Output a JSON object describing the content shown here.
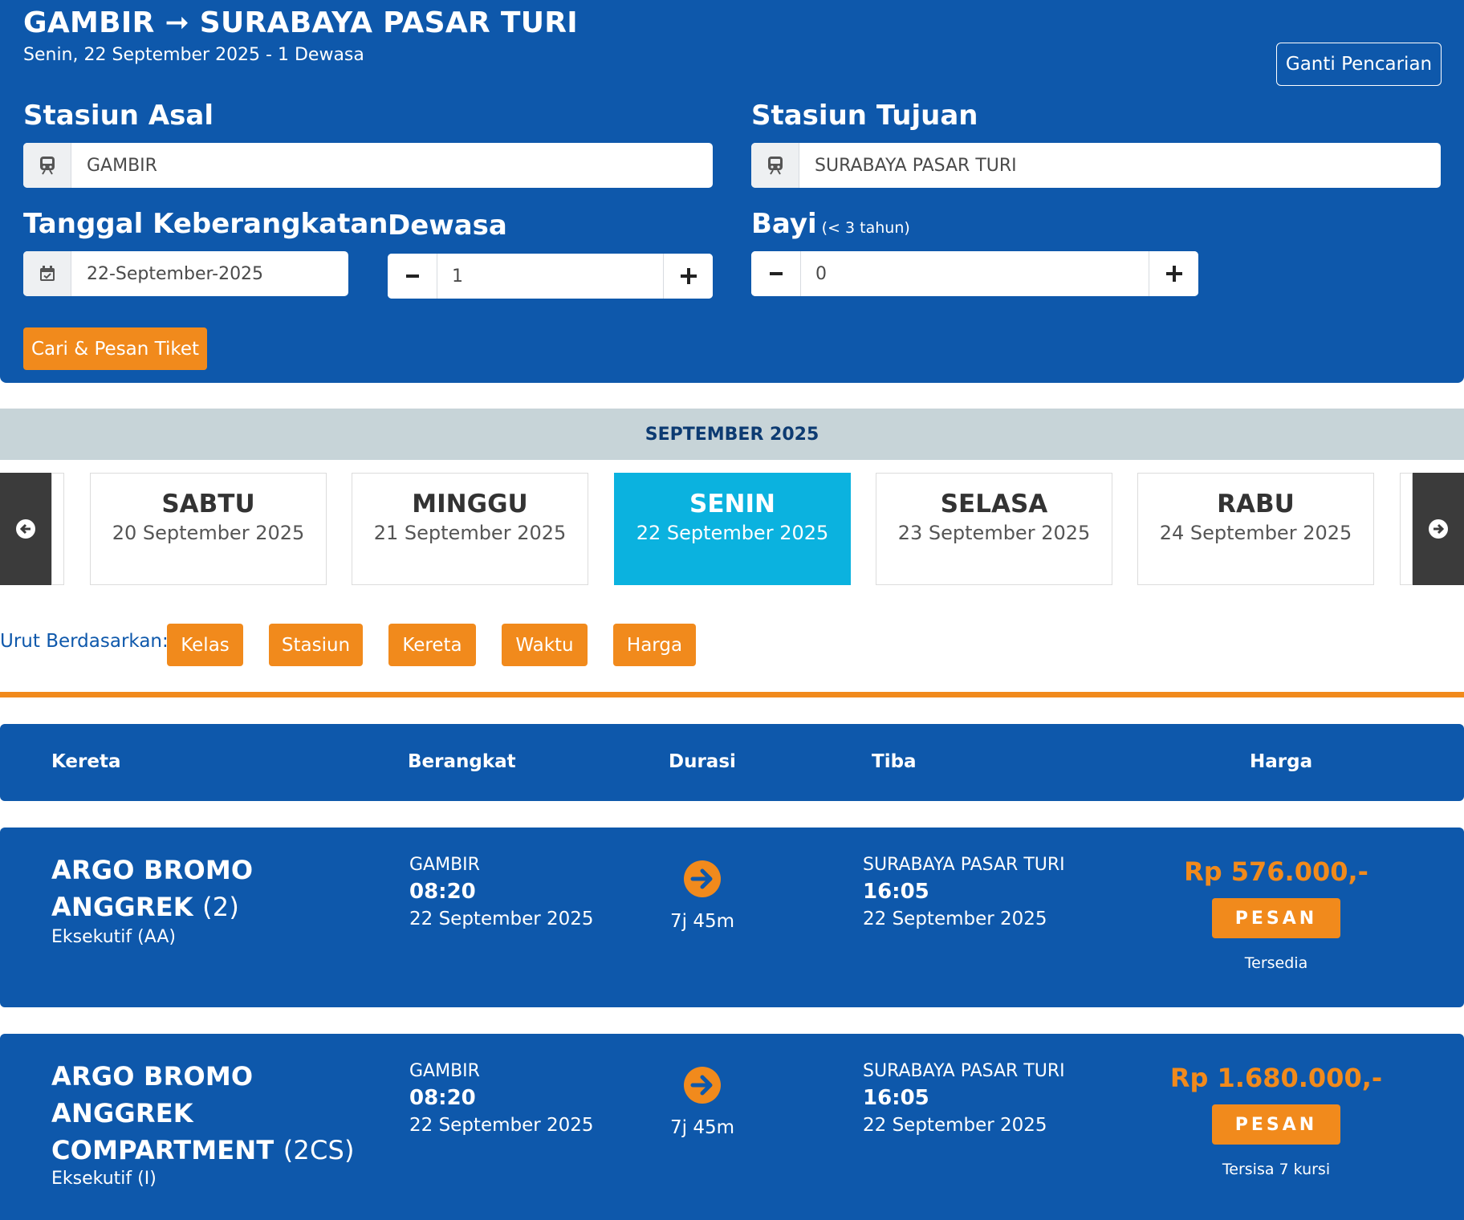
{
  "header": {
    "from": "GAMBIR",
    "arrow": "➞",
    "to": "SURABAYA PASAR TURI",
    "subtitle": "Senin, 22 September 2025 - 1 Dewasa",
    "change_button": "Ganti Pencarian"
  },
  "form": {
    "origin_label": "Stasiun Asal",
    "origin_value": "GAMBIR",
    "destination_label": "Stasiun Tujuan",
    "destination_value": "SURABAYA PASAR TURI",
    "date_label": "Tanggal Keberangkatan",
    "date_value": "22-September-2025",
    "adult_label": "Dewasa",
    "adult_value": "1",
    "infant_label": "Bayi",
    "infant_note": "(< 3 tahun)",
    "infant_value": "0",
    "search_button": "Cari & Pesan Tiket"
  },
  "calendar": {
    "month": "SEPTEMBER 2025",
    "days": [
      {
        "name": "SABTU",
        "date": "20 September 2025"
      },
      {
        "name": "MINGGU",
        "date": "21 September 2025"
      },
      {
        "name": "SENIN",
        "date": "22 September 2025"
      },
      {
        "name": "SELASA",
        "date": "23 September 2025"
      },
      {
        "name": "RABU",
        "date": "24 September 2025"
      }
    ],
    "active_index": 2
  },
  "sort": {
    "label": "Urut Berdasarkan:",
    "options": [
      "Kelas",
      "Stasiun",
      "Kereta",
      "Waktu",
      "Harga"
    ]
  },
  "table": {
    "headers": [
      "Kereta",
      "Berangkat",
      "Durasi",
      "Tiba",
      "Harga"
    ]
  },
  "results": [
    {
      "name": "ARGO BROMO ANGGREK",
      "code": "(2)",
      "class": "Eksekutif (AA)",
      "dep_station": "GAMBIR",
      "dep_time": "08:20",
      "dep_date": "22 September 2025",
      "duration": "7j 45m",
      "arr_station": "SURABAYA PASAR TURI",
      "arr_time": "16:05",
      "arr_date": "22 September 2025",
      "price": "Rp 576.000,-",
      "book_label": "PESAN",
      "availability": "Tersedia"
    },
    {
      "name": "ARGO BROMO ANGGREK COMPARTMENT",
      "code": "(2CS)",
      "class": "Eksekutif (I)",
      "dep_station": "GAMBIR",
      "dep_time": "08:20",
      "dep_date": "22 September 2025",
      "duration": "7j 45m",
      "arr_station": "SURABAYA PASAR TURI",
      "arr_time": "16:05",
      "arr_date": "22 September 2025",
      "price": "Rp 1.680.000,-",
      "book_label": "PESAN",
      "availability": "Tersisa 7 kursi"
    }
  ],
  "colors": {
    "primary": "#0e58ab",
    "accent": "#f18a1c",
    "active_day": "#0bb2df",
    "month_bar": "#c7d4d8"
  },
  "icons": {
    "station": "train-icon",
    "date": "calendar-check-icon",
    "minus": "minus-icon",
    "plus": "plus-icon",
    "prev": "arrow-circle-left-icon",
    "next": "arrow-circle-right-icon",
    "duration": "arrow-circle-right-icon"
  }
}
